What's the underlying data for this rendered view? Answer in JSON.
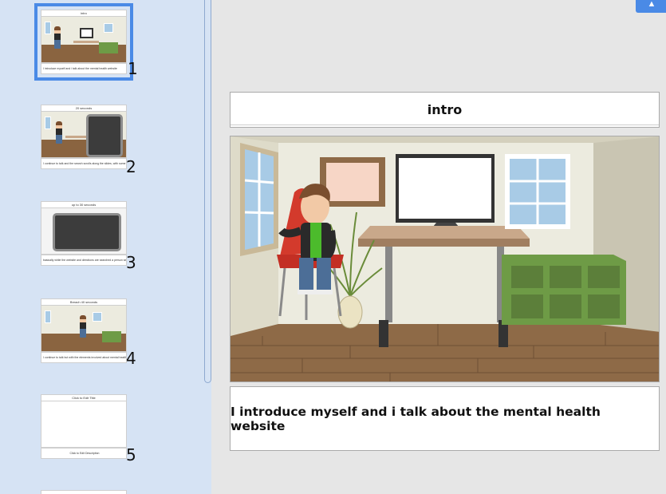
{
  "sidebar": {
    "slides": [
      {
        "number": "1",
        "title": "intro",
        "caption": "I introduce myself and i talk about the mental health website"
      },
      {
        "number": "2",
        "title": "20 seconds",
        "caption": "I continue to talk and the search scrolls along the slides, with some transit"
      },
      {
        "number": "3",
        "title": "up to 30 seconds",
        "caption": "basically while the website and directions are searched a person sees that"
      },
      {
        "number": "4",
        "title": "Breach 40 seconds",
        "caption": "I continue to talk but with the elements involved about mental health and the"
      },
      {
        "number": "5",
        "title": "Click to Edit Title",
        "caption": "Click to Edit Description"
      }
    ]
  },
  "main": {
    "title": "intro",
    "caption": "I introduce myself and i talk about the mental health website"
  },
  "colors": {
    "accent": "#4a8ae6",
    "sidebar_bg": "#d6e3f4",
    "canvas_bg": "#e6e6e6"
  },
  "icons": {
    "corner": "arrow-up-icon"
  }
}
